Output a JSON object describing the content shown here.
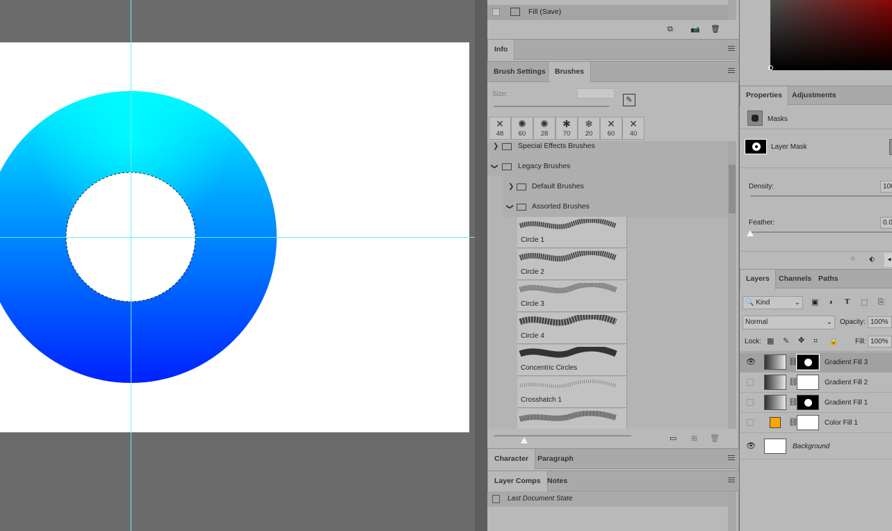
{
  "history": {
    "last_state_label": "Fill (Save)"
  },
  "info_panel": {
    "tab_label": "Info"
  },
  "brushes_panel": {
    "tabs": [
      "Brush Settings",
      "Brushes"
    ],
    "size_label": "Size:",
    "presets": [
      {
        "symbol": "✕",
        "size": "48"
      },
      {
        "symbol": "✺",
        "size": "60"
      },
      {
        "symbol": "✺",
        "size": "28"
      },
      {
        "symbol": "✱",
        "size": "70"
      },
      {
        "symbol": "❄",
        "size": "20"
      },
      {
        "symbol": "✕",
        "size": "60"
      },
      {
        "symbol": "✕",
        "size": "40"
      }
    ],
    "folders": {
      "special_effects": "Special Effects Brushes",
      "legacy": "Legacy Brushes",
      "default": "Default Brushes",
      "assorted": "Assorted Brushes"
    },
    "brushes": [
      "Circle 1",
      "Circle 2",
      "Circle 3",
      "Circle 4",
      "Concentric Circles",
      "Crosshatch 1"
    ]
  },
  "character_panel": {
    "tabs": [
      "Character",
      "Paragraph"
    ]
  },
  "layer_comps_panel": {
    "tabs": [
      "Layer Comps",
      "Notes"
    ],
    "item": "Last Document State"
  },
  "properties_panel": {
    "tabs": [
      "Properties",
      "Adjustments"
    ],
    "section": "Masks",
    "mask_type": "Layer Mask",
    "density_label": "Density:",
    "density_value": "100",
    "feather_label": "Feather:",
    "feather_value": "0.0"
  },
  "layers_panel": {
    "tabs": [
      "Layers",
      "Channels",
      "Paths"
    ],
    "filter_label": "Kind",
    "blend_mode": "Normal",
    "opacity_label": "Opacity:",
    "opacity_value": "100%",
    "lock_label": "Lock:",
    "fill_label": "Fill:",
    "fill_value": "100%",
    "layers": [
      {
        "name": "Gradient Fill 3",
        "visible": true,
        "selected": true
      },
      {
        "name": "Gradient Fill 2",
        "visible": false,
        "selected": false
      },
      {
        "name": "Gradient Fill 1",
        "visible": false,
        "selected": false
      },
      {
        "name": "Color Fill 1",
        "visible": false,
        "selected": false
      },
      {
        "name": "Background",
        "visible": true,
        "selected": false
      }
    ]
  },
  "colors": {
    "guide": "#5ff2f2",
    "ring_top": "#00f7ff",
    "ring_bottom": "#0028ff",
    "color_fill_swatch": "#ffa500"
  }
}
